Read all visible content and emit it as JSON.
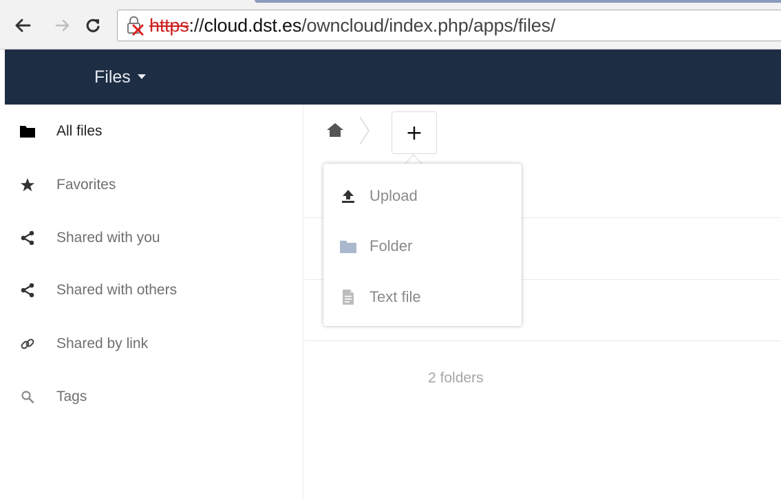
{
  "browser": {
    "url": {
      "scheme": "https",
      "separator": "://",
      "host": "cloud.dst.es",
      "path": "/owncloud/index.php/apps/files/"
    },
    "icons": {
      "back": "arrow-left-icon",
      "forward": "arrow-right-icon",
      "reload": "reload-icon",
      "security": "broken-lock-icon"
    }
  },
  "header": {
    "app_menu_label": "Files",
    "background_color": "#1d2d44"
  },
  "sidebar": {
    "items": [
      {
        "label": "All files",
        "icon": "folder-icon",
        "active": true
      },
      {
        "label": "Favorites",
        "icon": "star-icon",
        "active": false
      },
      {
        "label": "Shared with you",
        "icon": "share-icon",
        "active": false
      },
      {
        "label": "Shared with others",
        "icon": "share-icon",
        "active": false
      },
      {
        "label": "Shared by link",
        "icon": "link-icon",
        "active": false
      },
      {
        "label": "Tags",
        "icon": "search-icon",
        "active": false
      }
    ]
  },
  "breadcrumb": {
    "home_icon": "home-icon",
    "add_label": "+"
  },
  "new_menu": {
    "items": [
      {
        "label": "Upload",
        "icon": "upload-icon"
      },
      {
        "label": "Folder",
        "icon": "folder-icon"
      },
      {
        "label": "Text file",
        "icon": "text-file-icon"
      }
    ]
  },
  "file_list": {
    "summary": "2 folders"
  }
}
